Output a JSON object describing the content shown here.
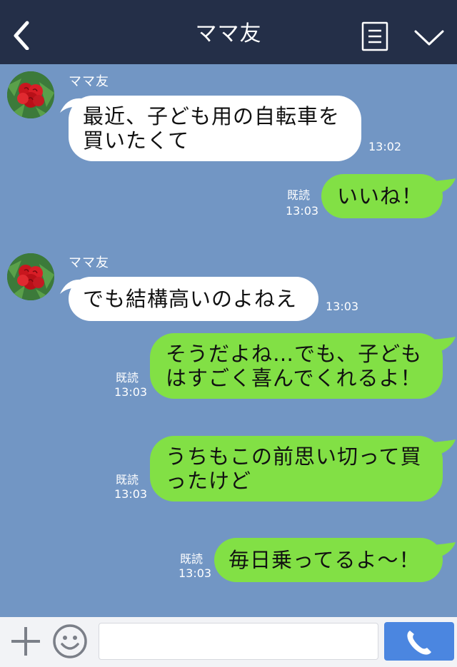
{
  "header": {
    "title": "ママ友"
  },
  "messages": [
    {
      "direction": "in",
      "sender": "ママ友",
      "lines": [
        "最近、子ども用の自転車を",
        "買いたくて"
      ],
      "time": "13:02"
    },
    {
      "direction": "out",
      "lines": [
        "いいね！"
      ],
      "read": "既読",
      "time": "13:03"
    },
    {
      "direction": "in",
      "sender": "ママ友",
      "lines": [
        "でも結構高いのよねえ"
      ],
      "time": "13:03"
    },
    {
      "direction": "out",
      "lines": [
        "そうだよね…でも、子ども",
        "はすごく喜んでくれるよ！"
      ],
      "read": "既読",
      "time": "13:03"
    },
    {
      "direction": "out",
      "lines": [
        "うちもこの前思い切って買",
        "ったけど"
      ],
      "read": "既読",
      "time": "13:03"
    },
    {
      "direction": "out",
      "lines": [
        "毎日乗ってるよ〜！"
      ],
      "read": "既読",
      "time": "13:03"
    }
  ],
  "input": {
    "value": ""
  },
  "colors": {
    "header_bg": "#242f48",
    "chat_bg": "#7296c4",
    "outgoing_bubble": "#82e045",
    "incoming_bubble": "#ffffff",
    "call_button": "#4b86e0"
  },
  "icons": {
    "back": "chevron-left-icon",
    "menu": "document-list-icon",
    "collapse": "chevron-down-icon",
    "plus": "plus-icon",
    "emoji": "smiley-icon",
    "call": "phone-icon"
  }
}
